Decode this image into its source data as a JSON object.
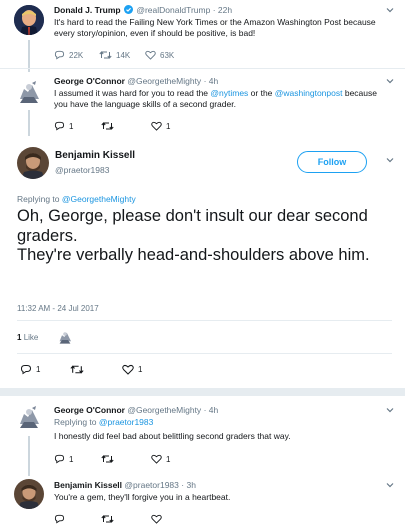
{
  "colors": {
    "accent": "#1da1f2",
    "mention": "#1b95e0",
    "muted": "#657786",
    "like": "#657786"
  },
  "tweet1": {
    "name": "Donald J. Trump",
    "verified_icon": "verified-badge-icon",
    "handle": "@realDonaldTrump",
    "time": "22h",
    "text": "It's hard to read the Failing New York Times or the Amazon Washington Post because every story/opinion, even if should be positive, is bad!",
    "replies": "22K",
    "retweets": "14K",
    "likes": "63K"
  },
  "tweet2": {
    "name": "George O'Connor",
    "handle": "@GeorgetheMighty",
    "time": "4h",
    "text_before": "I assumed it was hard for you to read the ",
    "mention1": "@nytimes",
    "text_middle": " or the ",
    "mention2": "@washingtonpost",
    "text_after": " because you have the language skills of a second grader.",
    "replies": "1",
    "likes": "1"
  },
  "main": {
    "name": "Benjamin Kissell",
    "handle": "@praetor1983",
    "follow_label": "Follow",
    "replying_prefix": "Replying to ",
    "replying_handle": "@GeorgetheMighty",
    "text_line1": "Oh, George, please don't insult our dear second graders.",
    "text_line2": "They're verbally head-and-shoulders above him.",
    "timestamp": "11:32 AM - 24 Jul 2017",
    "like_count": "1",
    "like_label": "Like",
    "replies": "1",
    "likes": "1"
  },
  "reply1": {
    "name": "George O'Connor",
    "handle": "@GeorgetheMighty",
    "time": "4h",
    "replying_prefix": "Replying to ",
    "replying_handle": "@praetor1983",
    "text": "I honestly did feel bad about belittling second graders that way.",
    "replies": "1",
    "likes": "1"
  },
  "reply2": {
    "name": "Benjamin Kissell",
    "handle": "@praetor1983",
    "time": "3h",
    "text": "You're a gem, they'll forgive you in a heartbeat."
  }
}
